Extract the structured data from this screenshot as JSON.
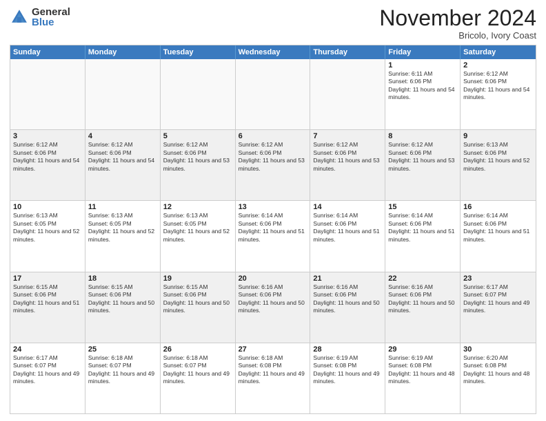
{
  "header": {
    "logo": {
      "general": "General",
      "blue": "Blue"
    },
    "title": "November 2024",
    "location": "Bricolo, Ivory Coast"
  },
  "weekdays": [
    "Sunday",
    "Monday",
    "Tuesday",
    "Wednesday",
    "Thursday",
    "Friday",
    "Saturday"
  ],
  "weeks": [
    [
      {
        "day": "",
        "empty": true
      },
      {
        "day": "",
        "empty": true
      },
      {
        "day": "",
        "empty": true
      },
      {
        "day": "",
        "empty": true
      },
      {
        "day": "",
        "empty": true
      },
      {
        "day": "1",
        "sunrise": "Sunrise: 6:11 AM",
        "sunset": "Sunset: 6:06 PM",
        "daylight": "Daylight: 11 hours and 54 minutes."
      },
      {
        "day": "2",
        "sunrise": "Sunrise: 6:12 AM",
        "sunset": "Sunset: 6:06 PM",
        "daylight": "Daylight: 11 hours and 54 minutes."
      }
    ],
    [
      {
        "day": "3",
        "sunrise": "Sunrise: 6:12 AM",
        "sunset": "Sunset: 6:06 PM",
        "daylight": "Daylight: 11 hours and 54 minutes."
      },
      {
        "day": "4",
        "sunrise": "Sunrise: 6:12 AM",
        "sunset": "Sunset: 6:06 PM",
        "daylight": "Daylight: 11 hours and 54 minutes."
      },
      {
        "day": "5",
        "sunrise": "Sunrise: 6:12 AM",
        "sunset": "Sunset: 6:06 PM",
        "daylight": "Daylight: 11 hours and 53 minutes."
      },
      {
        "day": "6",
        "sunrise": "Sunrise: 6:12 AM",
        "sunset": "Sunset: 6:06 PM",
        "daylight": "Daylight: 11 hours and 53 minutes."
      },
      {
        "day": "7",
        "sunrise": "Sunrise: 6:12 AM",
        "sunset": "Sunset: 6:06 PM",
        "daylight": "Daylight: 11 hours and 53 minutes."
      },
      {
        "day": "8",
        "sunrise": "Sunrise: 6:12 AM",
        "sunset": "Sunset: 6:06 PM",
        "daylight": "Daylight: 11 hours and 53 minutes."
      },
      {
        "day": "9",
        "sunrise": "Sunrise: 6:13 AM",
        "sunset": "Sunset: 6:06 PM",
        "daylight": "Daylight: 11 hours and 52 minutes."
      }
    ],
    [
      {
        "day": "10",
        "sunrise": "Sunrise: 6:13 AM",
        "sunset": "Sunset: 6:05 PM",
        "daylight": "Daylight: 11 hours and 52 minutes."
      },
      {
        "day": "11",
        "sunrise": "Sunrise: 6:13 AM",
        "sunset": "Sunset: 6:05 PM",
        "daylight": "Daylight: 11 hours and 52 minutes."
      },
      {
        "day": "12",
        "sunrise": "Sunrise: 6:13 AM",
        "sunset": "Sunset: 6:05 PM",
        "daylight": "Daylight: 11 hours and 52 minutes."
      },
      {
        "day": "13",
        "sunrise": "Sunrise: 6:14 AM",
        "sunset": "Sunset: 6:06 PM",
        "daylight": "Daylight: 11 hours and 51 minutes."
      },
      {
        "day": "14",
        "sunrise": "Sunrise: 6:14 AM",
        "sunset": "Sunset: 6:06 PM",
        "daylight": "Daylight: 11 hours and 51 minutes."
      },
      {
        "day": "15",
        "sunrise": "Sunrise: 6:14 AM",
        "sunset": "Sunset: 6:06 PM",
        "daylight": "Daylight: 11 hours and 51 minutes."
      },
      {
        "day": "16",
        "sunrise": "Sunrise: 6:14 AM",
        "sunset": "Sunset: 6:06 PM",
        "daylight": "Daylight: 11 hours and 51 minutes."
      }
    ],
    [
      {
        "day": "17",
        "sunrise": "Sunrise: 6:15 AM",
        "sunset": "Sunset: 6:06 PM",
        "daylight": "Daylight: 11 hours and 51 minutes."
      },
      {
        "day": "18",
        "sunrise": "Sunrise: 6:15 AM",
        "sunset": "Sunset: 6:06 PM",
        "daylight": "Daylight: 11 hours and 50 minutes."
      },
      {
        "day": "19",
        "sunrise": "Sunrise: 6:15 AM",
        "sunset": "Sunset: 6:06 PM",
        "daylight": "Daylight: 11 hours and 50 minutes."
      },
      {
        "day": "20",
        "sunrise": "Sunrise: 6:16 AM",
        "sunset": "Sunset: 6:06 PM",
        "daylight": "Daylight: 11 hours and 50 minutes."
      },
      {
        "day": "21",
        "sunrise": "Sunrise: 6:16 AM",
        "sunset": "Sunset: 6:06 PM",
        "daylight": "Daylight: 11 hours and 50 minutes."
      },
      {
        "day": "22",
        "sunrise": "Sunrise: 6:16 AM",
        "sunset": "Sunset: 6:06 PM",
        "daylight": "Daylight: 11 hours and 50 minutes."
      },
      {
        "day": "23",
        "sunrise": "Sunrise: 6:17 AM",
        "sunset": "Sunset: 6:07 PM",
        "daylight": "Daylight: 11 hours and 49 minutes."
      }
    ],
    [
      {
        "day": "24",
        "sunrise": "Sunrise: 6:17 AM",
        "sunset": "Sunset: 6:07 PM",
        "daylight": "Daylight: 11 hours and 49 minutes."
      },
      {
        "day": "25",
        "sunrise": "Sunrise: 6:18 AM",
        "sunset": "Sunset: 6:07 PM",
        "daylight": "Daylight: 11 hours and 49 minutes."
      },
      {
        "day": "26",
        "sunrise": "Sunrise: 6:18 AM",
        "sunset": "Sunset: 6:07 PM",
        "daylight": "Daylight: 11 hours and 49 minutes."
      },
      {
        "day": "27",
        "sunrise": "Sunrise: 6:18 AM",
        "sunset": "Sunset: 6:08 PM",
        "daylight": "Daylight: 11 hours and 49 minutes."
      },
      {
        "day": "28",
        "sunrise": "Sunrise: 6:19 AM",
        "sunset": "Sunset: 6:08 PM",
        "daylight": "Daylight: 11 hours and 49 minutes."
      },
      {
        "day": "29",
        "sunrise": "Sunrise: 6:19 AM",
        "sunset": "Sunset: 6:08 PM",
        "daylight": "Daylight: 11 hours and 48 minutes."
      },
      {
        "day": "30",
        "sunrise": "Sunrise: 6:20 AM",
        "sunset": "Sunset: 6:08 PM",
        "daylight": "Daylight: 11 hours and 48 minutes."
      }
    ]
  ]
}
